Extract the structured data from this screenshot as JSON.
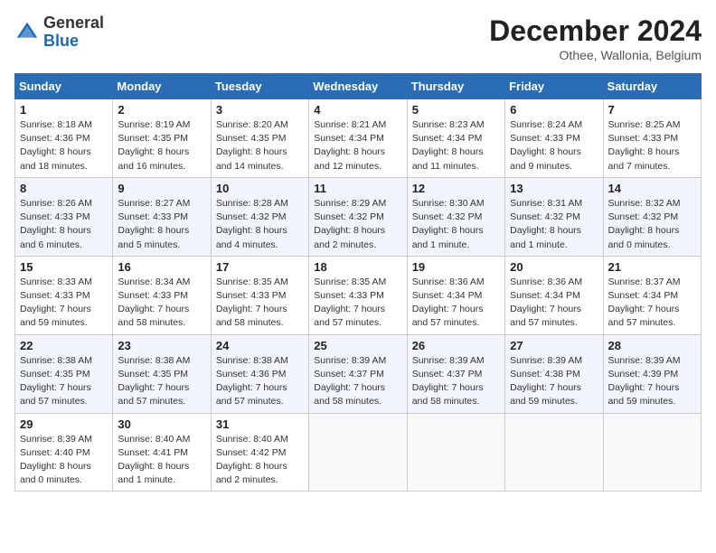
{
  "header": {
    "logo_general": "General",
    "logo_blue": "Blue",
    "month_title": "December 2024",
    "location": "Othee, Wallonia, Belgium"
  },
  "days_of_week": [
    "Sunday",
    "Monday",
    "Tuesday",
    "Wednesday",
    "Thursday",
    "Friday",
    "Saturday"
  ],
  "weeks": [
    [
      {
        "day": "1",
        "info": "Sunrise: 8:18 AM\nSunset: 4:36 PM\nDaylight: 8 hours and 18 minutes."
      },
      {
        "day": "2",
        "info": "Sunrise: 8:19 AM\nSunset: 4:35 PM\nDaylight: 8 hours and 16 minutes."
      },
      {
        "day": "3",
        "info": "Sunrise: 8:20 AM\nSunset: 4:35 PM\nDaylight: 8 hours and 14 minutes."
      },
      {
        "day": "4",
        "info": "Sunrise: 8:21 AM\nSunset: 4:34 PM\nDaylight: 8 hours and 12 minutes."
      },
      {
        "day": "5",
        "info": "Sunrise: 8:23 AM\nSunset: 4:34 PM\nDaylight: 8 hours and 11 minutes."
      },
      {
        "day": "6",
        "info": "Sunrise: 8:24 AM\nSunset: 4:33 PM\nDaylight: 8 hours and 9 minutes."
      },
      {
        "day": "7",
        "info": "Sunrise: 8:25 AM\nSunset: 4:33 PM\nDaylight: 8 hours and 7 minutes."
      }
    ],
    [
      {
        "day": "8",
        "info": "Sunrise: 8:26 AM\nSunset: 4:33 PM\nDaylight: 8 hours and 6 minutes."
      },
      {
        "day": "9",
        "info": "Sunrise: 8:27 AM\nSunset: 4:33 PM\nDaylight: 8 hours and 5 minutes."
      },
      {
        "day": "10",
        "info": "Sunrise: 8:28 AM\nSunset: 4:32 PM\nDaylight: 8 hours and 4 minutes."
      },
      {
        "day": "11",
        "info": "Sunrise: 8:29 AM\nSunset: 4:32 PM\nDaylight: 8 hours and 2 minutes."
      },
      {
        "day": "12",
        "info": "Sunrise: 8:30 AM\nSunset: 4:32 PM\nDaylight: 8 hours and 1 minute."
      },
      {
        "day": "13",
        "info": "Sunrise: 8:31 AM\nSunset: 4:32 PM\nDaylight: 8 hours and 1 minute."
      },
      {
        "day": "14",
        "info": "Sunrise: 8:32 AM\nSunset: 4:32 PM\nDaylight: 8 hours and 0 minutes."
      }
    ],
    [
      {
        "day": "15",
        "info": "Sunrise: 8:33 AM\nSunset: 4:33 PM\nDaylight: 7 hours and 59 minutes."
      },
      {
        "day": "16",
        "info": "Sunrise: 8:34 AM\nSunset: 4:33 PM\nDaylight: 7 hours and 58 minutes."
      },
      {
        "day": "17",
        "info": "Sunrise: 8:35 AM\nSunset: 4:33 PM\nDaylight: 7 hours and 58 minutes."
      },
      {
        "day": "18",
        "info": "Sunrise: 8:35 AM\nSunset: 4:33 PM\nDaylight: 7 hours and 57 minutes."
      },
      {
        "day": "19",
        "info": "Sunrise: 8:36 AM\nSunset: 4:34 PM\nDaylight: 7 hours and 57 minutes."
      },
      {
        "day": "20",
        "info": "Sunrise: 8:36 AM\nSunset: 4:34 PM\nDaylight: 7 hours and 57 minutes."
      },
      {
        "day": "21",
        "info": "Sunrise: 8:37 AM\nSunset: 4:34 PM\nDaylight: 7 hours and 57 minutes."
      }
    ],
    [
      {
        "day": "22",
        "info": "Sunrise: 8:38 AM\nSunset: 4:35 PM\nDaylight: 7 hours and 57 minutes."
      },
      {
        "day": "23",
        "info": "Sunrise: 8:38 AM\nSunset: 4:35 PM\nDaylight: 7 hours and 57 minutes."
      },
      {
        "day": "24",
        "info": "Sunrise: 8:38 AM\nSunset: 4:36 PM\nDaylight: 7 hours and 57 minutes."
      },
      {
        "day": "25",
        "info": "Sunrise: 8:39 AM\nSunset: 4:37 PM\nDaylight: 7 hours and 58 minutes."
      },
      {
        "day": "26",
        "info": "Sunrise: 8:39 AM\nSunset: 4:37 PM\nDaylight: 7 hours and 58 minutes."
      },
      {
        "day": "27",
        "info": "Sunrise: 8:39 AM\nSunset: 4:38 PM\nDaylight: 7 hours and 59 minutes."
      },
      {
        "day": "28",
        "info": "Sunrise: 8:39 AM\nSunset: 4:39 PM\nDaylight: 7 hours and 59 minutes."
      }
    ],
    [
      {
        "day": "29",
        "info": "Sunrise: 8:39 AM\nSunset: 4:40 PM\nDaylight: 8 hours and 0 minutes."
      },
      {
        "day": "30",
        "info": "Sunrise: 8:40 AM\nSunset: 4:41 PM\nDaylight: 8 hours and 1 minute."
      },
      {
        "day": "31",
        "info": "Sunrise: 8:40 AM\nSunset: 4:42 PM\nDaylight: 8 hours and 2 minutes."
      },
      null,
      null,
      null,
      null
    ]
  ]
}
